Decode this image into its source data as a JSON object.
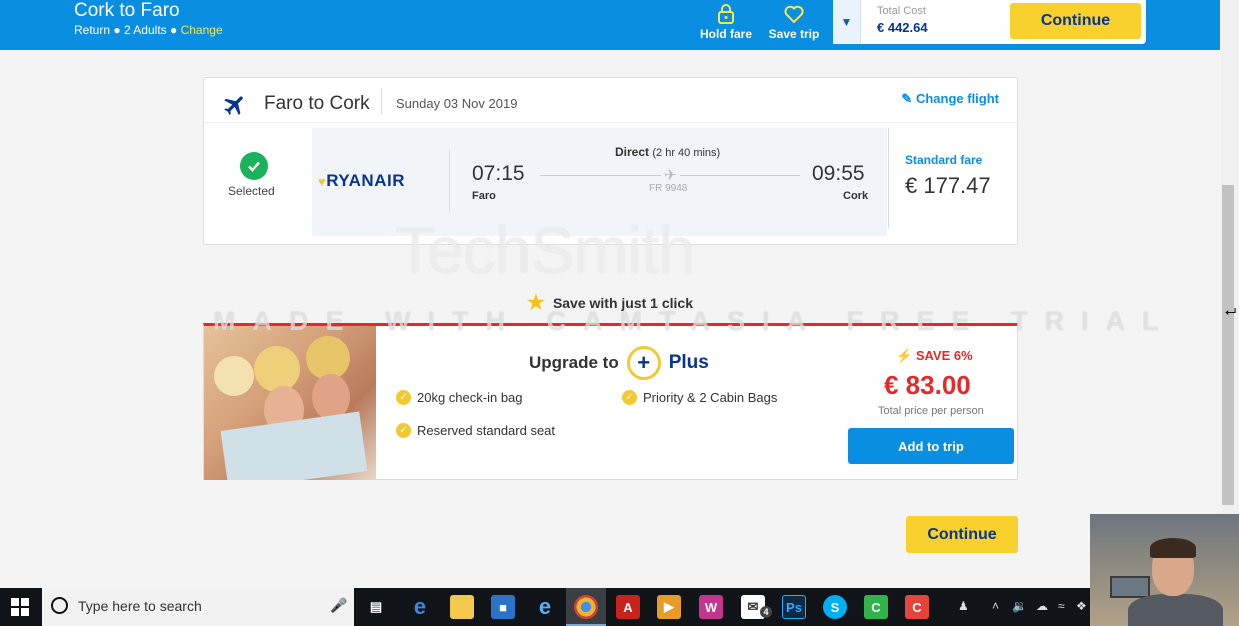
{
  "header": {
    "title": "Cork to Faro",
    "sub_trip": "Return",
    "sub_pax": "2 Adults",
    "sub_change": "Change",
    "hold_fare": "Hold fare",
    "save_trip": "Save trip",
    "total_cost_label": "Total Cost",
    "total_cost_value": "€ 442.64",
    "continue": "Continue"
  },
  "flight": {
    "route": "Faro to Cork",
    "date": "Sunday 03 Nov 2019",
    "change_flight": "Change flight",
    "selected": "Selected",
    "airline": "RYANAIR",
    "dep_time": "07:15",
    "dep_city": "Faro",
    "arr_time": "09:55",
    "arr_city": "Cork",
    "direct": "Direct",
    "duration": "(2 hr 40 mins)",
    "flight_number": "FR 9948",
    "fare_label": "Standard fare",
    "fare_value": "€ 177.47"
  },
  "save_click": "Save with just 1 click",
  "upgrade": {
    "title": "Upgrade to",
    "plus_symbol": "+",
    "plus_word": "Plus",
    "features": [
      "20kg check-in bag",
      "Priority & 2 Cabin Bags",
      "Reserved standard seat"
    ],
    "save_pct": "SAVE 6%",
    "price": "€ 83.00",
    "per_person": "Total price per person",
    "add_to_trip": "Add to trip"
  },
  "continue_bottom": "Continue",
  "watermark": {
    "brand": "TechSmith",
    "trial": "MADE WITH CAMTASIA FREE TRIAL"
  },
  "taskbar": {
    "search_placeholder": "Type here to search",
    "mail_badge": "4"
  },
  "colors": {
    "brand_blue": "#0a8ee2",
    "navy": "#073590",
    "yellow": "#f8d12f",
    "red": "#e32a2a",
    "green": "#1ab25a"
  }
}
